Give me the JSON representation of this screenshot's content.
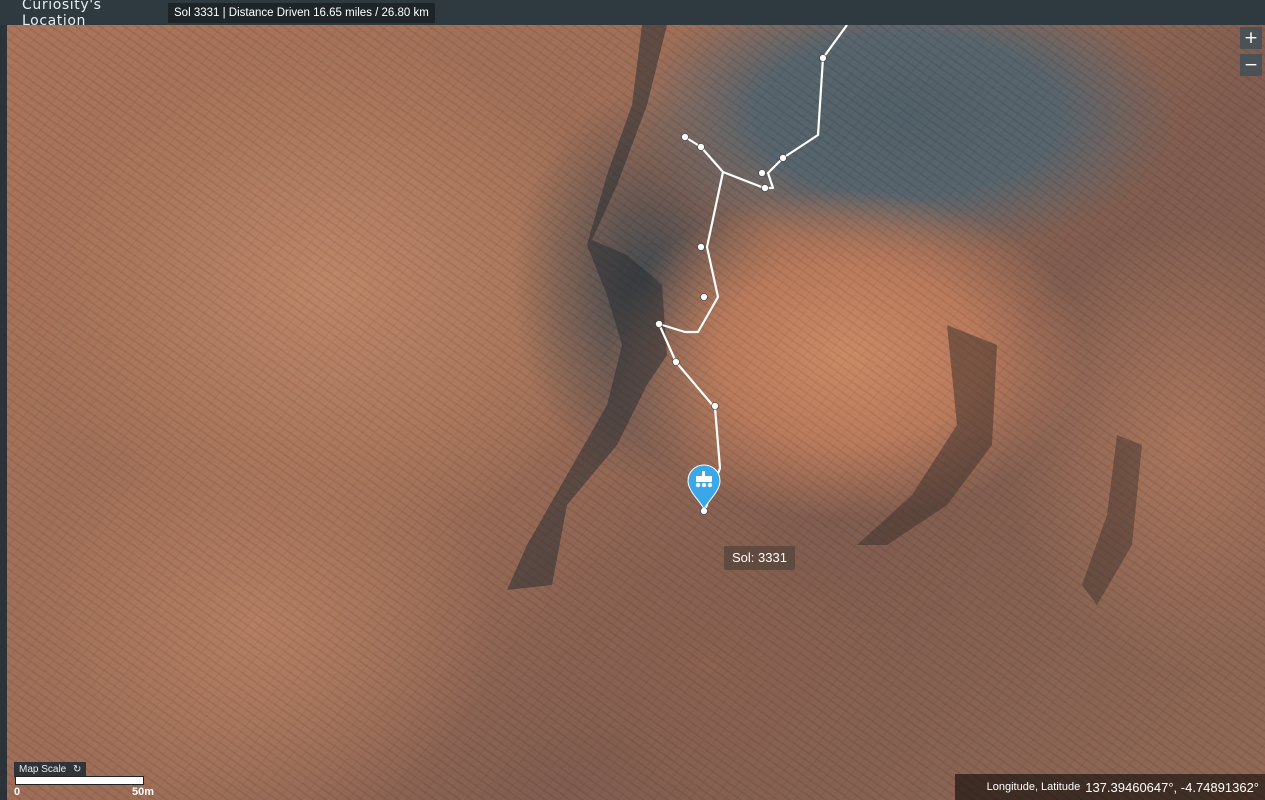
{
  "header": {
    "title": "Curiosity's Location",
    "sol_info": "Sol 3331 | Distance Driven 16.65 miles / 26.80 km"
  },
  "zoom": {
    "in_label": "+",
    "out_label": "−"
  },
  "marker": {
    "label": "Sol: 3331"
  },
  "scale": {
    "title": "Map Scale",
    "refresh_glyph": "↻",
    "zero": "0",
    "end": "50m"
  },
  "coords": {
    "label": "Longitude, Latitude",
    "value": "137.39460647°, -4.74891362°"
  },
  "colors": {
    "route": "#ffffff",
    "marker": "#3aa7e8",
    "header_bg": "#2f3a40"
  },
  "icons": {
    "marker": "rover-map-pin-icon",
    "zoom_in": "plus-icon",
    "zoom_out": "minus-icon",
    "refresh": "refresh-icon"
  }
}
